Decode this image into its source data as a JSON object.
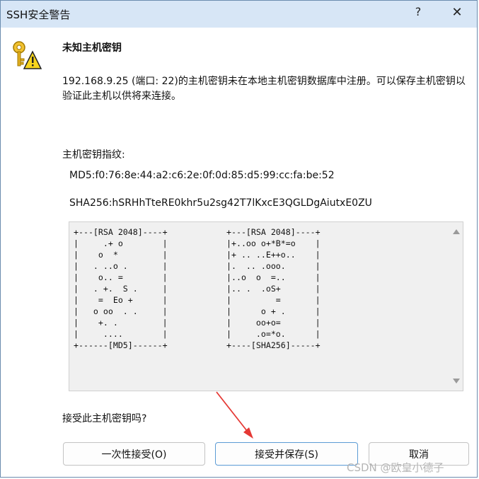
{
  "window": {
    "title": "SSH安全警告",
    "help_label": "?",
    "close_label": "✕"
  },
  "content": {
    "heading": "未知主机密钥",
    "message": "192.168.9.25 (端口: 22)的主机密钥未在本地主机密钥数据库中注册。可以保存主机密钥以验证此主机以供将来连接。",
    "fingerprint_label": "主机密钥指纹:",
    "md5_fingerprint": "MD5:f0:76:8e:44:a2:c6:2e:0f:0d:85:d5:99:cc:fa:be:52",
    "sha256_fingerprint": "SHA256:hSRHhTteRE0khr5u2sg42T7lKxcE3QGLDgAiutxE0ZU",
    "randomart_md5": "+---[RSA 2048]----+\n|     .+ o        |\n|    o  *         |\n|   . ..o .       |\n|    o.. =        |\n|   . +.  S .     |\n|    =  Eo +      |\n|   o oo  . .     |\n|    +. .         |\n|     ....        |\n+------[MD5]------+",
    "randomart_sha256": "+---[RSA 2048]----+\n|+..oo o+*B*=o    |\n|+ .. ..E++o..    |\n|.  .. .ooo.      |\n|..o  o  =..      |\n|.. .  .oS+       |\n|         =       |\n|      o + .      |\n|     oo+o=       |\n|     .o=*o.      |\n+----[SHA256]-----+",
    "question": "接受此主机密钥吗?"
  },
  "buttons": {
    "once": "一次性接受(O)",
    "accept_save": "接受并保存(S)",
    "cancel": "取消"
  },
  "watermark": "CSDN @欧皇小德子",
  "colors": {
    "titlebar": "#d7e6f6",
    "annotation_arrow": "#e53935",
    "default_button_border": "#5b9bd5"
  }
}
